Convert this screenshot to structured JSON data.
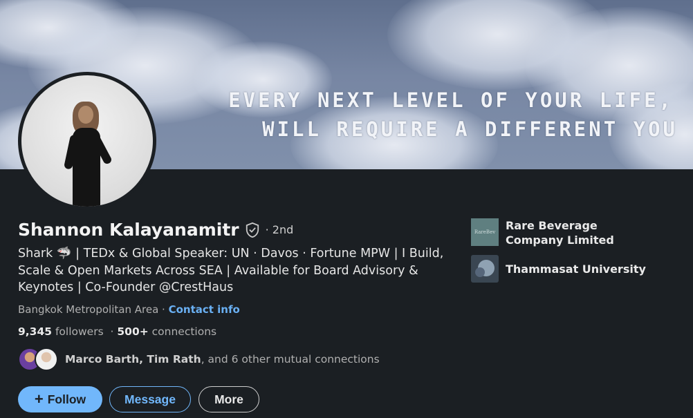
{
  "banner": {
    "line1": "EVERY NEXT LEVEL OF YOUR LIFE,",
    "line2": "WILL REQUIRE A DIFFERENT YOU"
  },
  "profile": {
    "name": "Shannon Kalayanamitr",
    "degree": "· 2nd",
    "headline": "Shark 🦈 | TEDx & Global Speaker: UN · Davos · Fortune MPW | I Build, Scale & Open Markets Across SEA | Available for Board Advisory & Keynotes | Co-Founder @CrestHaus",
    "location": "Bangkok Metropolitan Area",
    "location_sep": " · ",
    "contact_info": "Contact info",
    "followers": "9,345",
    "followers_label": " followers",
    "connections_sep": "  · ",
    "connections": "500+",
    "connections_label": " connections"
  },
  "mutual": {
    "names": "Marco Barth, Tim Rath",
    "rest": ", and 6 other mutual connections"
  },
  "actions": {
    "follow": "Follow",
    "message": "Message",
    "more": "More"
  },
  "orgs": [
    {
      "name": "Rare Beverage Company Limited",
      "logo_text": "RareBev"
    },
    {
      "name": "Thammasat University"
    }
  ],
  "colors": {
    "accent": "#71b7fb",
    "link": "#6ab0f3",
    "background": "#1b1f23"
  }
}
